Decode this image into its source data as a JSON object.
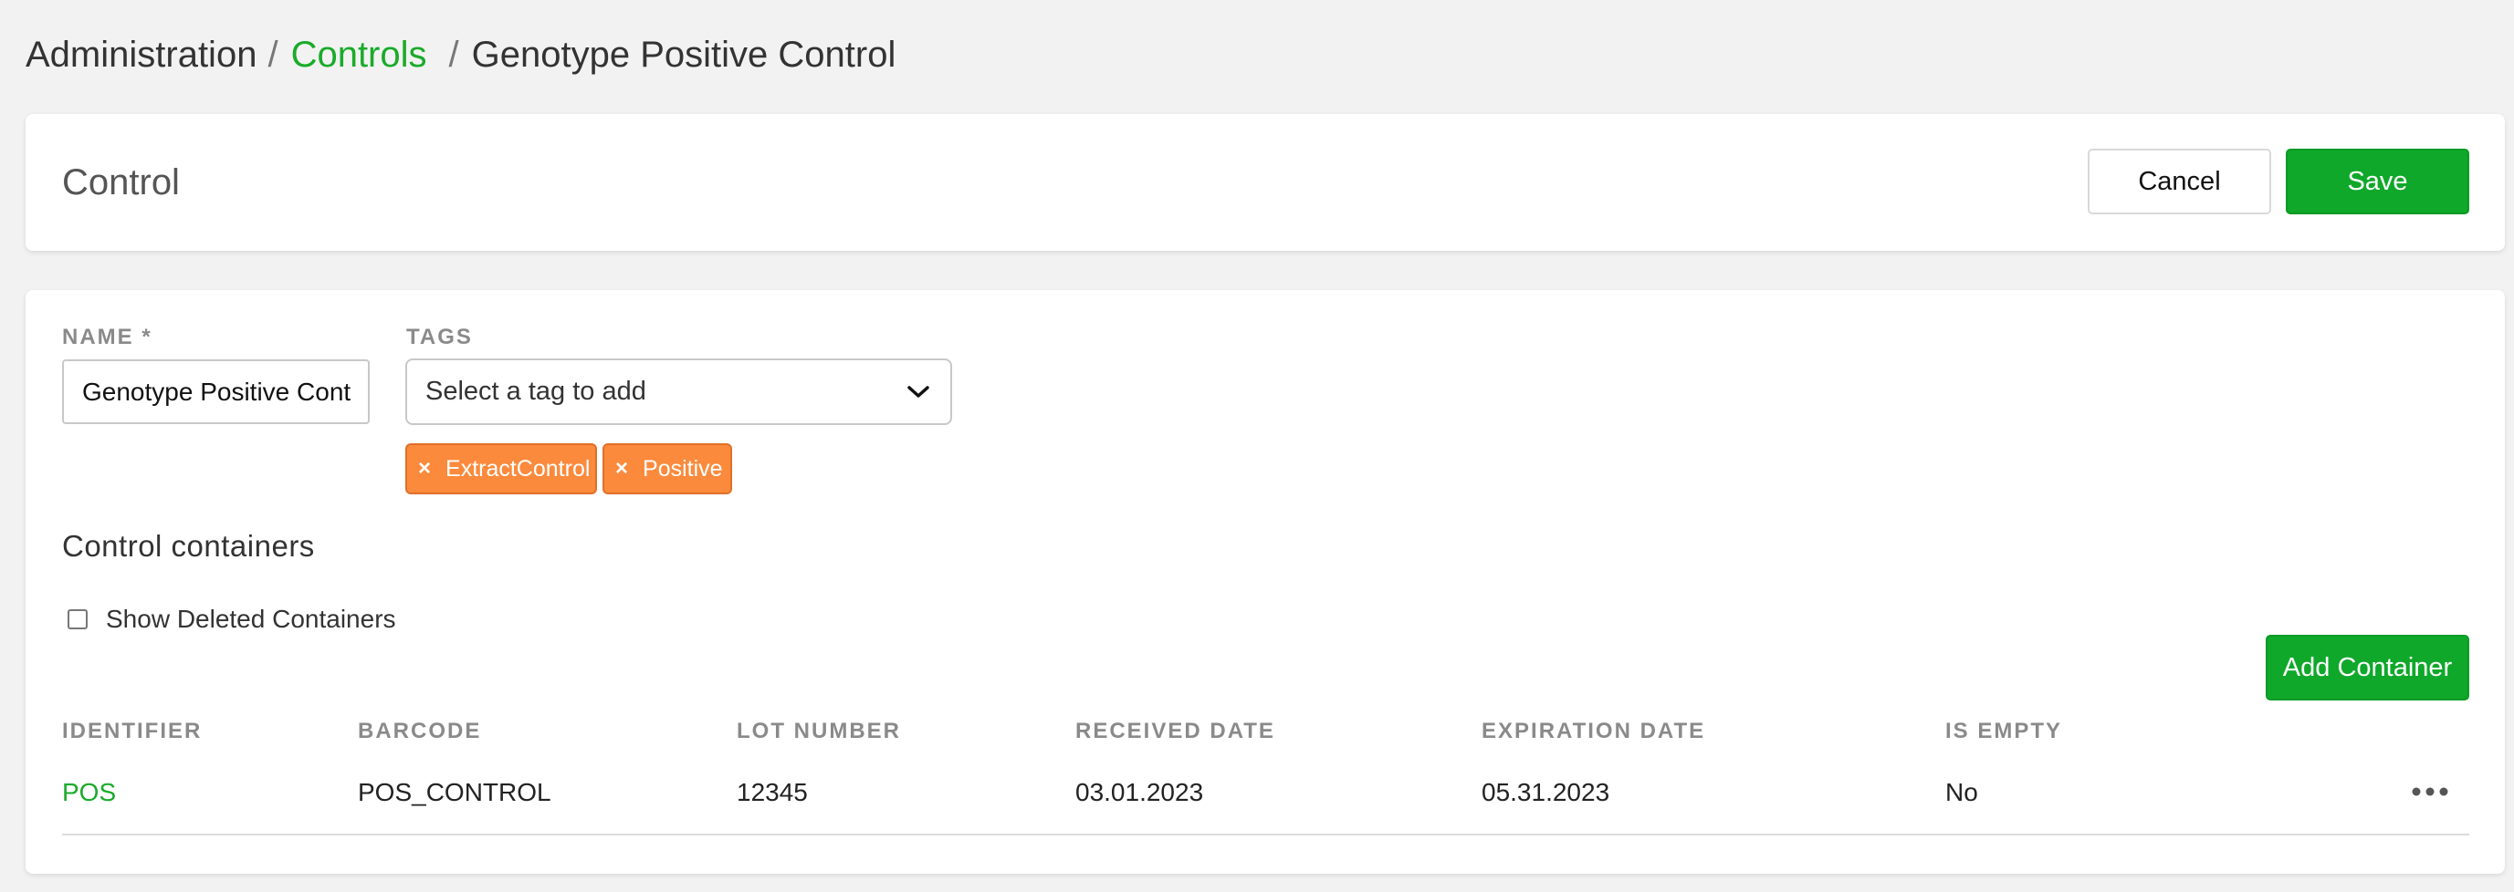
{
  "breadcrumb": {
    "root": "Administration",
    "controls": "Controls",
    "current": "Genotype Positive Control",
    "sep": "/"
  },
  "header": {
    "title": "Control",
    "cancel_label": "Cancel",
    "save_label": "Save"
  },
  "form": {
    "name_label": "NAME *",
    "name_value": "Genotype Positive Cont",
    "tags_label": "TAGS",
    "tags_placeholder": "Select a tag to add",
    "tags": [
      "ExtractControl",
      "Positive"
    ]
  },
  "containers": {
    "title": "Control containers",
    "show_deleted_label": "Show Deleted Containers",
    "show_deleted_checked": false,
    "add_label": "Add Container",
    "columns": [
      "IDENTIFIER",
      "BARCODE",
      "LOT NUMBER",
      "RECEIVED DATE",
      "EXPIRATION DATE",
      "IS EMPTY"
    ],
    "rows": [
      {
        "identifier": "POS",
        "barcode": "POS_CONTROL",
        "lot_number": "12345",
        "received_date": "03.01.2023",
        "expiration_date": "05.31.2023",
        "is_empty": "No"
      }
    ]
  },
  "icons": {
    "chevron": "chevron-down-icon",
    "remove_tag": "close-icon",
    "more": "more-horizontal-icon"
  },
  "colors": {
    "accent": "#1aab2a",
    "primary_button": "#0fa82a",
    "tag": "#fb8a3c",
    "background": "#f2f2f2"
  }
}
